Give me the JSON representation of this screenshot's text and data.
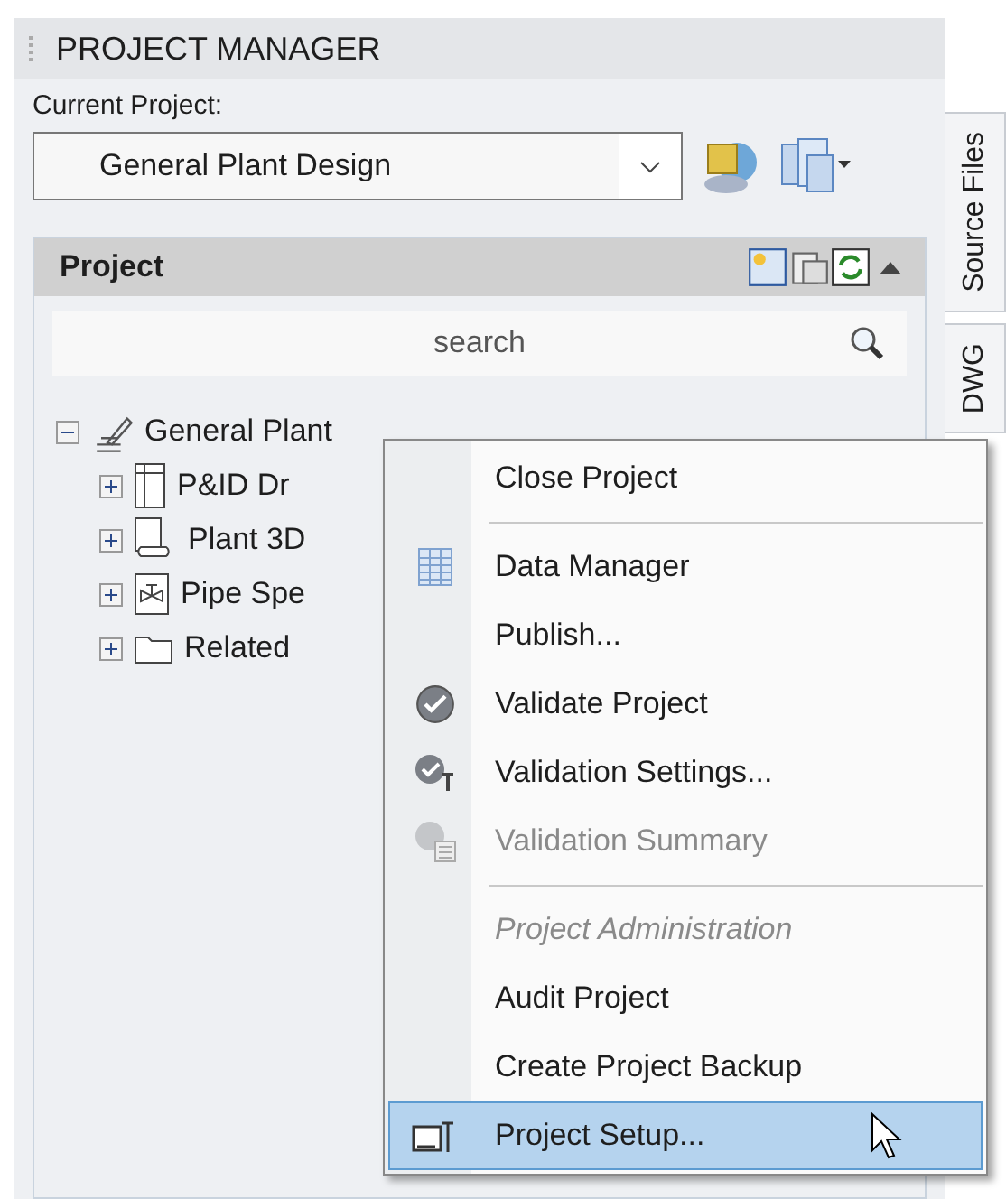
{
  "panel": {
    "title": "PROJECT MANAGER"
  },
  "current_project": {
    "label": "Current Project:",
    "value": "General Plant Design"
  },
  "project_section": {
    "title": "Project",
    "expanded": true
  },
  "search": {
    "placeholder": "search"
  },
  "tree": [
    {
      "label": "General Plant",
      "kind": "project",
      "expanded": true,
      "children": [
        {
          "label": "P&ID Dr",
          "kind": "drawings",
          "expanded": false
        },
        {
          "label": "Plant 3D",
          "kind": "plant",
          "expanded": false
        },
        {
          "label": "Pipe Spe",
          "kind": "specs",
          "expanded": false
        },
        {
          "label": "Related",
          "kind": "folder",
          "expanded": false
        }
      ]
    }
  ],
  "side_tabs": [
    {
      "label": "Source Files"
    },
    {
      "label": "DWG"
    }
  ],
  "context_menu": [
    {
      "kind": "item",
      "label": "Close Project",
      "disabled": false,
      "selected": false
    },
    {
      "kind": "separator"
    },
    {
      "kind": "item",
      "label": "Data Manager",
      "disabled": false,
      "selected": false
    },
    {
      "kind": "item",
      "label": "Publish...",
      "disabled": false,
      "selected": false
    },
    {
      "kind": "item",
      "label": "Validate Project",
      "disabled": false,
      "selected": false
    },
    {
      "kind": "item",
      "label": "Validation Settings...",
      "disabled": false,
      "selected": false
    },
    {
      "kind": "item",
      "label": "Validation Summary",
      "disabled": true,
      "selected": false
    },
    {
      "kind": "separator"
    },
    {
      "kind": "heading",
      "label": "Project Administration"
    },
    {
      "kind": "item",
      "label": "Audit Project",
      "disabled": false,
      "selected": false
    },
    {
      "kind": "item",
      "label": "Create Project Backup",
      "disabled": false,
      "selected": false
    },
    {
      "kind": "item",
      "label": "Project Setup...",
      "disabled": false,
      "selected": true
    }
  ]
}
